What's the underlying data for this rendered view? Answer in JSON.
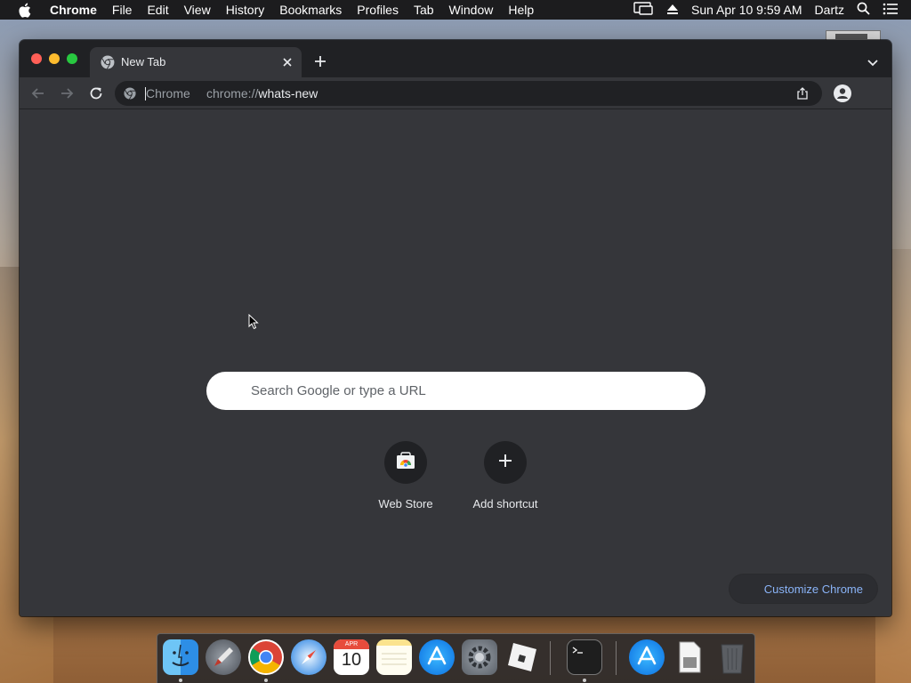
{
  "menubar": {
    "app_name": "Chrome",
    "menus": [
      "File",
      "Edit",
      "View",
      "History",
      "Bookmarks",
      "Profiles",
      "Tab",
      "Window",
      "Help"
    ],
    "clock": "Sun Apr 10  9:59 AM",
    "user": "Dartz"
  },
  "window": {
    "tab": {
      "title": "New Tab"
    },
    "omnibox": {
      "chip_label": "Chrome",
      "url_scheme": "chrome://",
      "url_host": "whats-new"
    }
  },
  "newtab": {
    "search_placeholder": "Search Google or type a URL",
    "shortcuts": [
      {
        "label": "Web Store",
        "icon": "webstore-icon"
      },
      {
        "label": "Add shortcut",
        "icon": "plus-icon"
      }
    ],
    "customize_label": "Customize Chrome"
  },
  "dock": {
    "apps": [
      "Finder",
      "Launchpad",
      "Google Chrome",
      "Safari",
      "Calendar",
      "Notes",
      "App Store",
      "System Preferences",
      "Roblox",
      "Terminal",
      "App Store Downloads",
      "Documents",
      "Trash"
    ],
    "calendar_month": "APR",
    "calendar_day": "10"
  },
  "colors": {
    "window_bg": "#35363a",
    "tabstrip_bg": "#202124",
    "accent_link": "#8ab4f8",
    "close": "#ff5f57",
    "minimize": "#febc2e",
    "maximize": "#28c840"
  }
}
